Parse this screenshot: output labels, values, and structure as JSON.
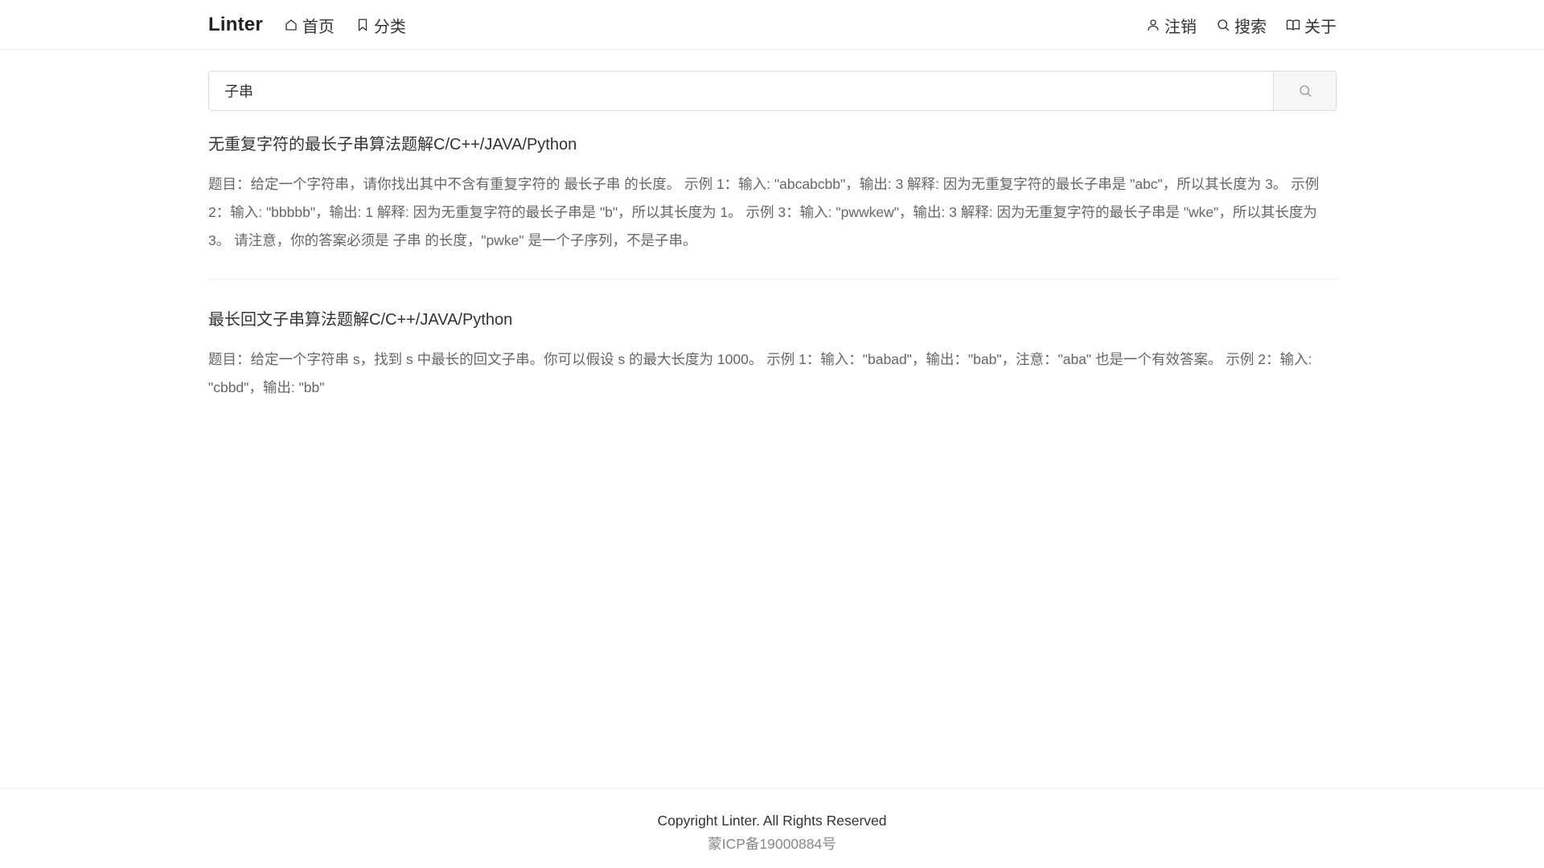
{
  "header": {
    "brand": "Linter",
    "nav_left": [
      {
        "label": "首页",
        "icon": "home-icon"
      },
      {
        "label": "分类",
        "icon": "bookmark-icon"
      }
    ],
    "nav_right": [
      {
        "label": "注销",
        "icon": "user-icon"
      },
      {
        "label": "搜索",
        "icon": "search-icon"
      },
      {
        "label": "关于",
        "icon": "book-icon"
      }
    ]
  },
  "search": {
    "value": "子串",
    "placeholder": ""
  },
  "results": [
    {
      "title": "无重复字符的最长子串算法题解C/C++/JAVA/Python",
      "excerpt": "题目：给定一个字符串，请你找出其中不含有重复字符的 最长子串 的长度。 示例 1：输入: \"abcabcbb\"，输出: 3 解释: 因为无重复字符的最长子串是 \"abc\"，所以其长度为 3。 示例 2：输入: \"bbbbb\"，输出: 1 解释: 因为无重复字符的最长子串是 \"b\"，所以其长度为 1。 示例 3：输入: \"pwwkew\"，输出: 3 解释: 因为无重复字符的最长子串是 \"wke\"，所以其长度为 3。 请注意，你的答案必须是 子串 的长度，\"pwke\" 是一个子序列，不是子串。"
    },
    {
      "title": "最长回文子串算法题解C/C++/JAVA/Python",
      "excerpt": "题目：给定一个字符串 s，找到 s 中最长的回文子串。你可以假设 s 的最大长度为 1000。 示例 1：输入：\"babad\"，输出：\"bab\"，注意：\"aba\" 也是一个有效答案。 示例 2：输入: \"cbbd\"，输出: \"bb\""
    }
  ],
  "footer": {
    "copyright": "Copyright Linter. All Rights Reserved",
    "icp": "蒙ICP备19000884号"
  },
  "colors": {
    "text": "#333333",
    "muted": "#666666",
    "border": "#dcdcdc",
    "button_bg": "#f5f6f7"
  }
}
